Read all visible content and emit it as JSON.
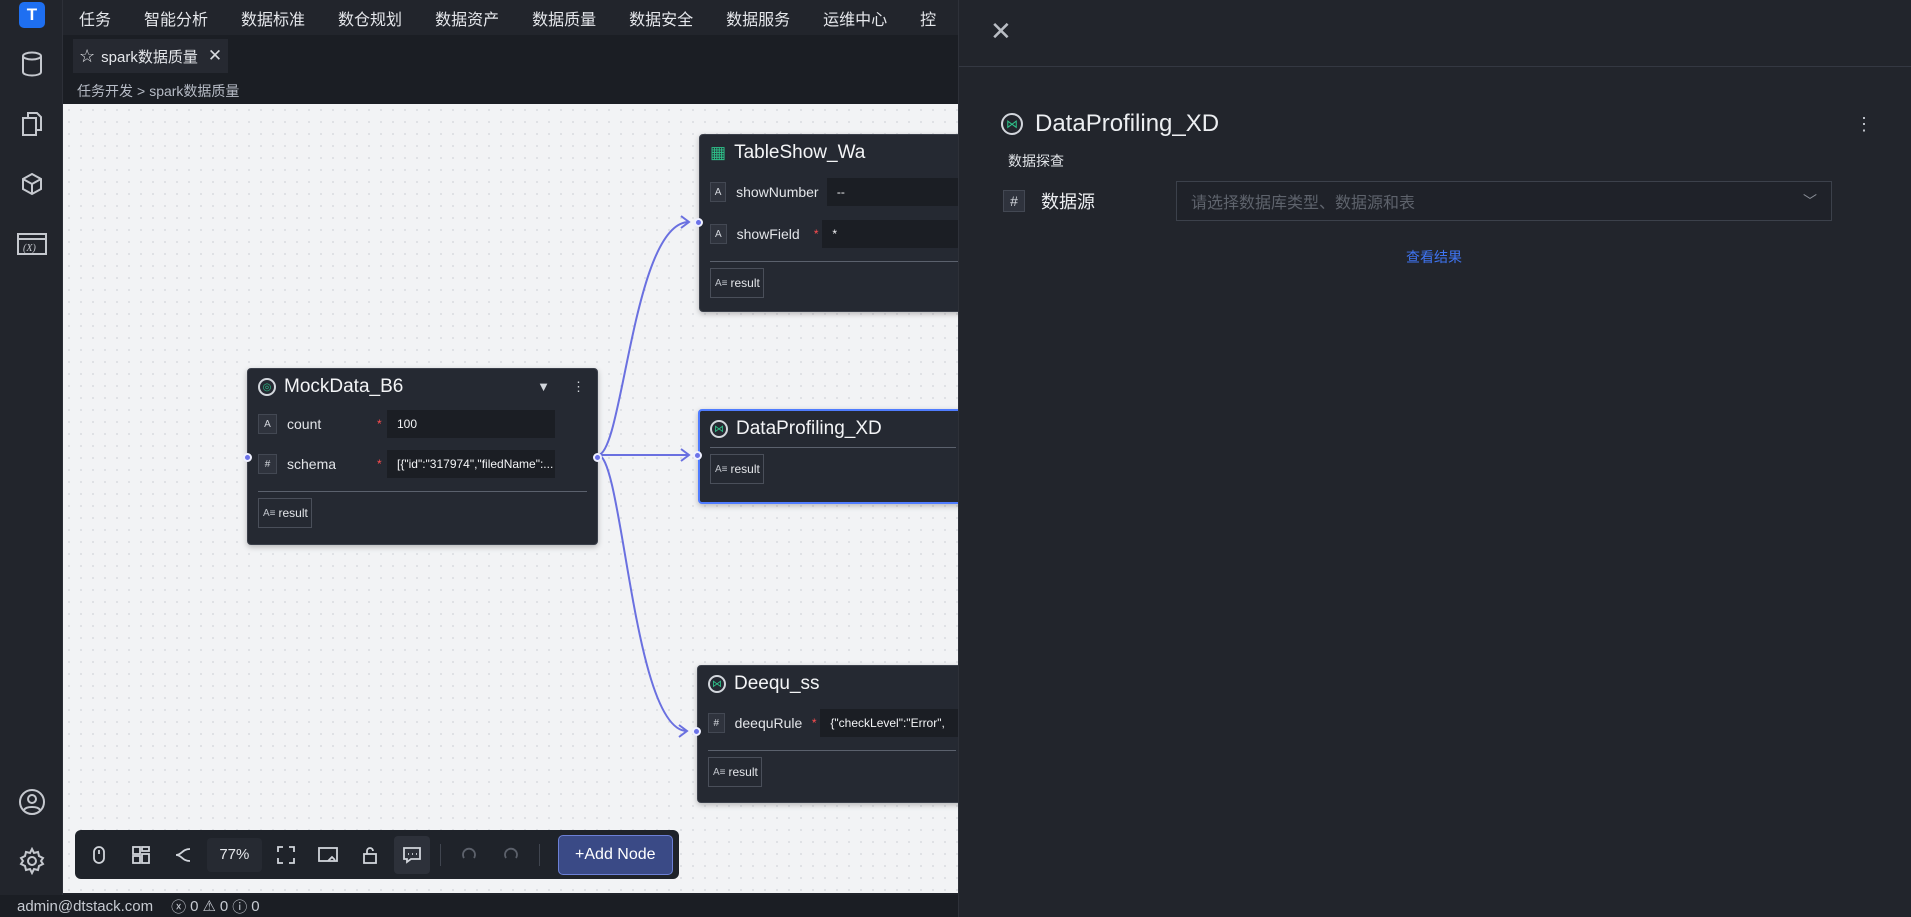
{
  "app": {
    "logo_glyph": "T",
    "accent": "#1e6ff1"
  },
  "top_menu": [
    "任务",
    "智能分析",
    "数据标准",
    "数仓规划",
    "数据资产",
    "数据质量",
    "数据安全",
    "数据服务",
    "运维中心",
    "控"
  ],
  "tab": {
    "label": "spark数据质量",
    "close": "✕"
  },
  "breadcrumb": {
    "root": "任务开发",
    "sep": ">",
    "current": "spark数据质量"
  },
  "nodes": {
    "mock": {
      "title": "MockData_B6",
      "params": [
        {
          "name": "count",
          "type": "A",
          "value": "100"
        },
        {
          "name": "schema",
          "type": "#",
          "value": "[{\"id\":\"317974\",\"filedName\":..."
        }
      ],
      "output": "result"
    },
    "table": {
      "title": "TableShow_Wa",
      "params": [
        {
          "name": "showNumber",
          "type": "A",
          "value": "--"
        },
        {
          "name": "showField",
          "type": "A",
          "value": "*"
        }
      ],
      "output": "result"
    },
    "profiling": {
      "title": "DataProfiling_XD",
      "output": "result"
    },
    "deequ": {
      "title": "Deequ_ss",
      "params": [
        {
          "name": "deequRule",
          "type": "#",
          "value": "{\"checkLevel\":\"Error\","
        }
      ],
      "output": "result"
    }
  },
  "toolbar": {
    "zoom": "77%",
    "add_node": "+Add Node"
  },
  "status": {
    "user": "admin@dtstack.com",
    "errors": "0",
    "warnings": "0",
    "infos": "0"
  },
  "drawer": {
    "title": "DataProfiling_XD",
    "subtitle": "数据探查",
    "field_label": "数据源",
    "field_type": "#",
    "select_placeholder": "请选择数据库类型、数据源和表",
    "link": "查看结果"
  }
}
